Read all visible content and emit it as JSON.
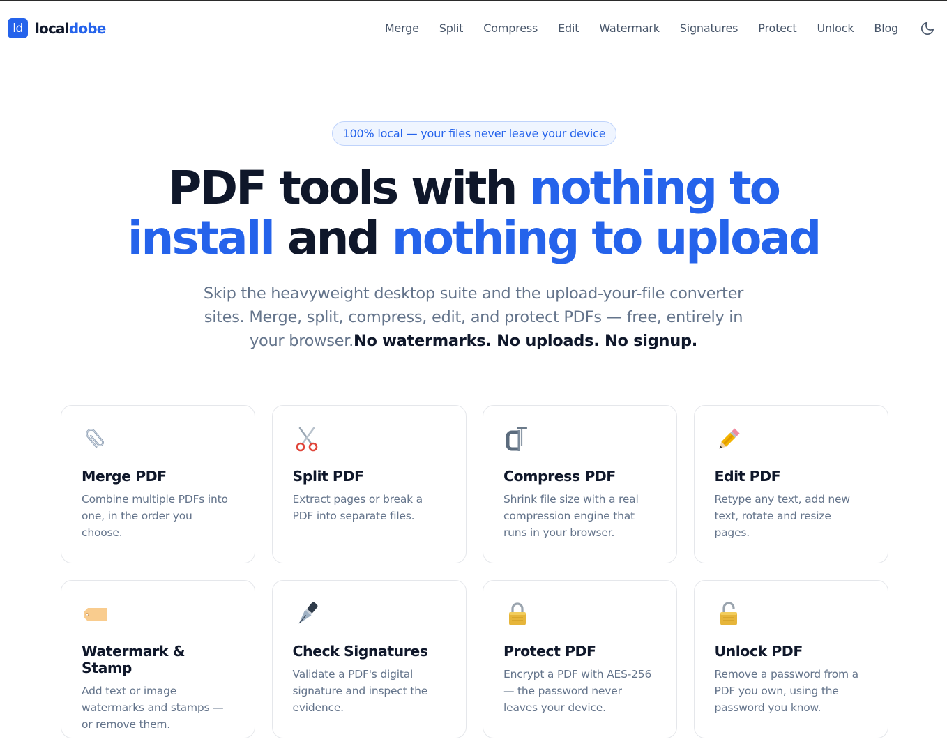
{
  "brand": {
    "mark": "ld",
    "name_a": "local",
    "name_b": "dobe",
    "accent": "#2563eb"
  },
  "nav": {
    "items": [
      "Merge",
      "Split",
      "Compress",
      "Edit",
      "Watermark",
      "Signatures",
      "Protect",
      "Unlock",
      "Blog"
    ]
  },
  "theme_toggle": {
    "icon": "moon-icon"
  },
  "hero": {
    "badge": "100% local — your files never leave your device",
    "title_1": "PDF tools with ",
    "title_2": "nothing to",
    "title_3": "install",
    "title_4": " and ",
    "title_5": "nothing to upload",
    "lead": "Skip the heavyweight desktop suite and the upload-your-file converter sites. Merge, split, compress, edit, and protect PDFs — free, entirely in your browser.",
    "lead_strong": "No watermarks. No uploads. No signup."
  },
  "tools": [
    {
      "icon": "paperclip-icon",
      "title": "Merge PDF",
      "desc": "Combine multiple PDFs into one, in the order you choose."
    },
    {
      "icon": "scissors-icon",
      "title": "Split PDF",
      "desc": "Extract pages or break a PDF into separate files."
    },
    {
      "icon": "clamp-icon",
      "title": "Compress PDF",
      "desc": "Shrink file size with a real compression engine that runs in your browser."
    },
    {
      "icon": "pencil-icon",
      "title": "Edit PDF",
      "desc": "Retype any text, add new text, rotate and resize pages."
    },
    {
      "icon": "tag-icon",
      "title": "Watermark & Stamp",
      "desc": "Add text or image watermarks and stamps — or remove them."
    },
    {
      "icon": "fountain-pen-icon",
      "title": "Check Signatures",
      "desc": "Validate a PDF's digital signature and inspect the evidence."
    },
    {
      "icon": "lock-icon",
      "title": "Protect PDF",
      "desc": "Encrypt a PDF with AES-256 — the password never leaves your device."
    },
    {
      "icon": "unlock-icon",
      "title": "Unlock PDF",
      "desc": "Remove a password from a PDF you own, using the password you know."
    }
  ]
}
